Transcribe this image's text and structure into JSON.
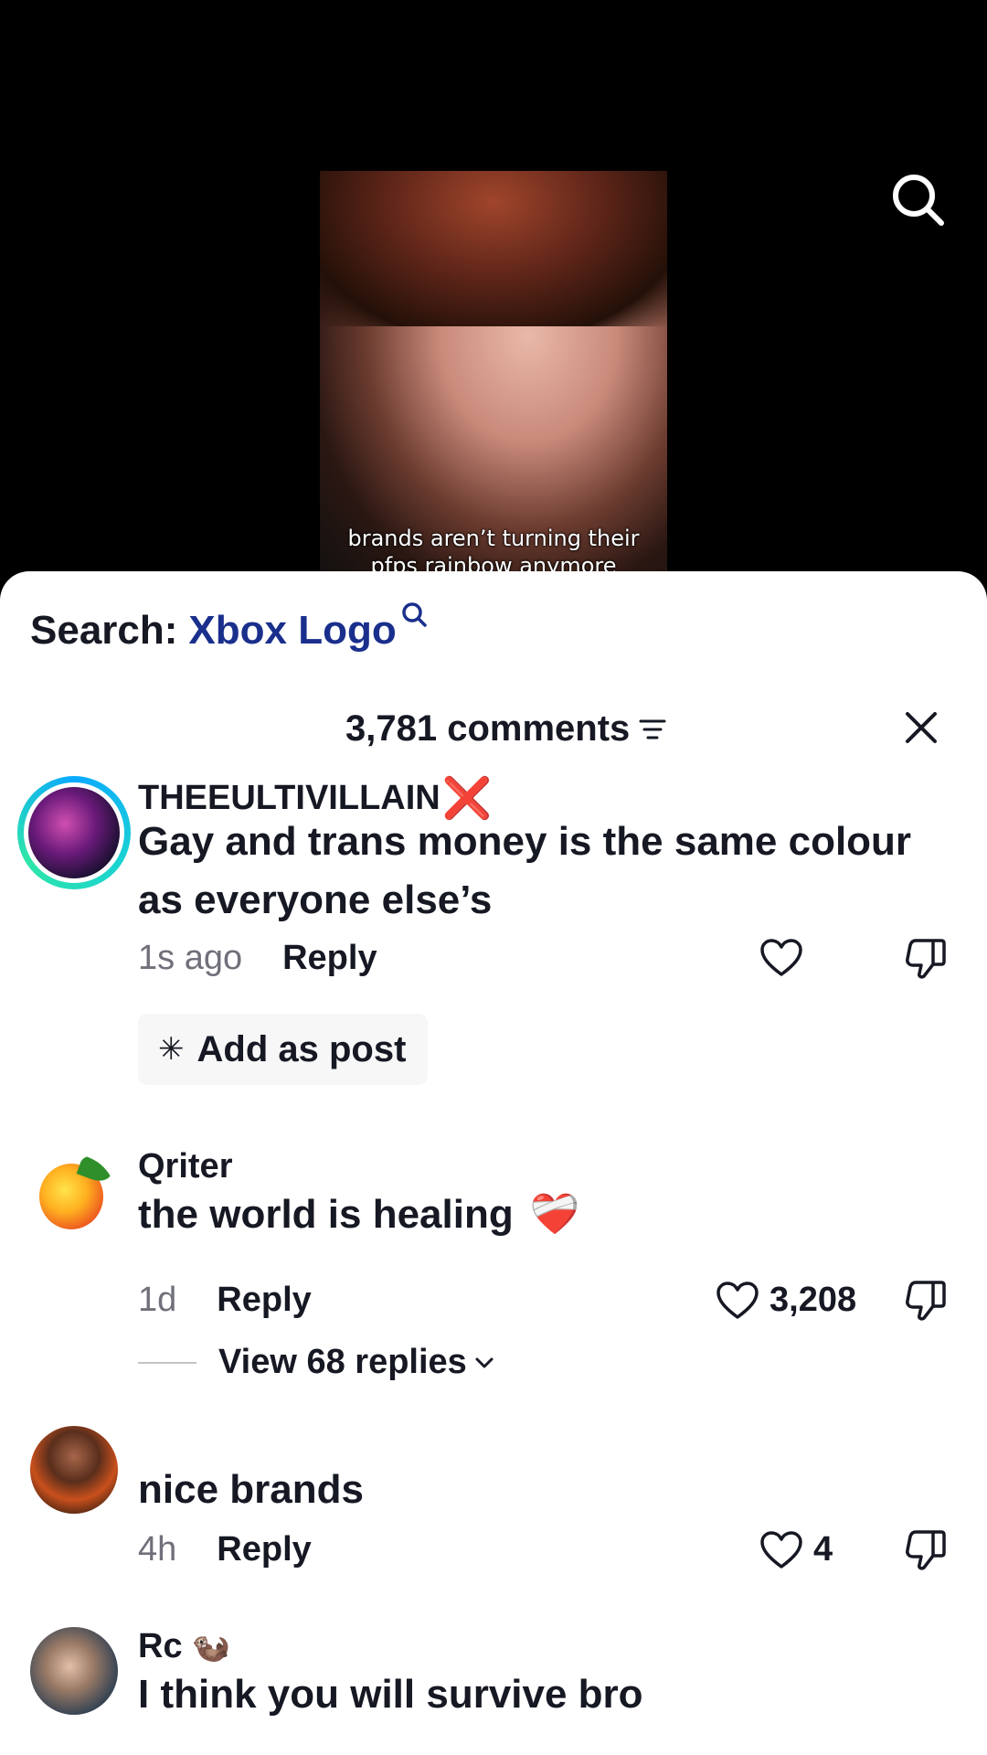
{
  "video": {
    "caption_line1": "brands aren’t turning their",
    "caption_line2": "pfps rainbow anymore"
  },
  "sheet": {
    "search_label": "Search:",
    "search_term": "Xbox Logo",
    "comments_count": "3,781 comments"
  },
  "comments": [
    {
      "username": "THEEULTIVILLAIN",
      "username_badge": "❌",
      "text": "Gay and trans money is the same colour as everyone else’s",
      "time": "1s ago",
      "reply": "Reply",
      "likes": "",
      "add_as_post": "Add as post"
    },
    {
      "username": "Qriter",
      "text": "the world is healing",
      "emoji": "❤️‍🩹",
      "time": "1d",
      "reply": "Reply",
      "likes": "3,208",
      "view_replies": "View 68 replies"
    },
    {
      "username": "",
      "text": "nice brands",
      "time": "4h",
      "reply": "Reply",
      "likes": "4"
    },
    {
      "username": "Rc",
      "username_emoji": "🦦",
      "text": "I think you will survive bro"
    }
  ],
  "colors": {
    "accent": "#1a2f8c",
    "text_primary": "#161823",
    "text_secondary": "#6f707a",
    "sheet_bg": "#ffffff",
    "video_bg": "#000000"
  }
}
